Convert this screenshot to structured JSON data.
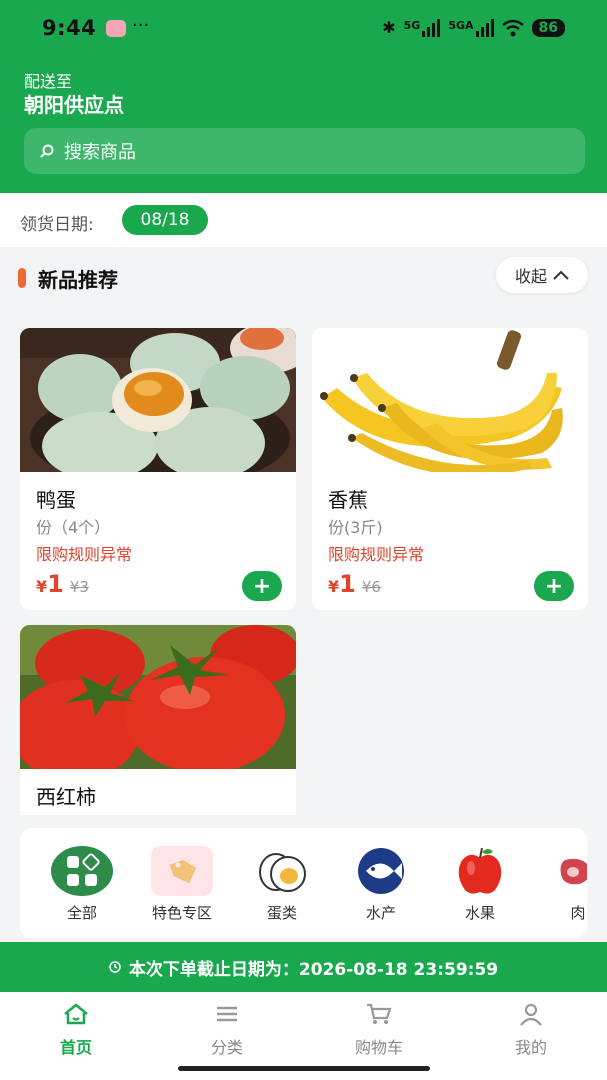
{
  "status_bar": {
    "time": "9:44",
    "dots": "···",
    "network1": "5G",
    "network2": "5GA",
    "battery": "86"
  },
  "header": {
    "deliver_label": "配送至",
    "deliver_place": "朝阳供应点",
    "search_placeholder": "搜索商品"
  },
  "pickup": {
    "label": "领货日期:",
    "date": "08/18"
  },
  "section": {
    "title": "新品推荐",
    "collapse_label": "收起"
  },
  "products": [
    {
      "name": "鸭蛋",
      "spec": "份（4个）",
      "warning": "限购规则异常",
      "currency": "¥",
      "price": "1",
      "old_price": "¥3"
    },
    {
      "name": "香蕉",
      "spec": "份(3斤)",
      "warning": "限购规则异常",
      "currency": "¥",
      "price": "1",
      "old_price": "¥6"
    },
    {
      "name": "西红柿"
    }
  ],
  "categories": [
    {
      "label": "全部",
      "icon": "grid-icon"
    },
    {
      "label": "特色专区",
      "icon": "tag-icon"
    },
    {
      "label": "蛋类",
      "icon": "egg-icon"
    },
    {
      "label": "水产",
      "icon": "fish-icon"
    },
    {
      "label": "水果",
      "icon": "apple-icon"
    },
    {
      "label": "肉",
      "icon": "meat-icon"
    }
  ],
  "deadline": {
    "text": "本次下单截止日期为：2026-08-18 23:59:59"
  },
  "tabs": [
    {
      "label": "首页",
      "icon": "home-icon",
      "active": true
    },
    {
      "label": "分类",
      "icon": "menu-icon",
      "active": false
    },
    {
      "label": "购物车",
      "icon": "cart-icon",
      "active": false
    },
    {
      "label": "我的",
      "icon": "user-icon",
      "active": false
    }
  ],
  "colors": {
    "brand_green": "#1aa84f",
    "price_red": "#e0442c",
    "section_accent": "#ec6b35"
  }
}
